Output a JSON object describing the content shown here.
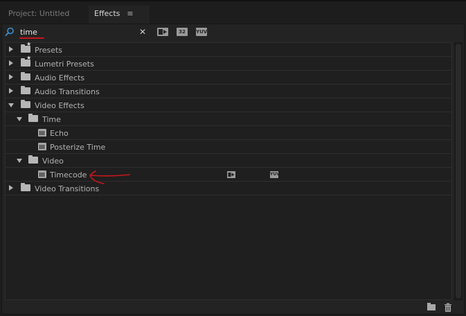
{
  "tabs": {
    "project": "Project: Untitled",
    "effects": "Effects",
    "menu_glyph": "≡"
  },
  "search": {
    "value": "time",
    "placeholder": "",
    "clear_glyph": "✕"
  },
  "filter_badges": {
    "accelerated": "",
    "bit32": "32",
    "yuv": "YUV"
  },
  "tree": {
    "presets": "Presets",
    "lumetri_presets": "Lumetri Presets",
    "audio_effects": "Audio Effects",
    "audio_transitions": "Audio Transitions",
    "video_effects": "Video Effects",
    "time": "Time",
    "echo": "Echo",
    "posterize_time": "Posterize Time",
    "video": "Video",
    "timecode": "Timecode",
    "video_transitions": "Video Transitions"
  },
  "row_badges": {
    "yuv": "YUV"
  },
  "colors": {
    "annotation": "#c8161b",
    "accent_search": "#3d8fd1"
  }
}
